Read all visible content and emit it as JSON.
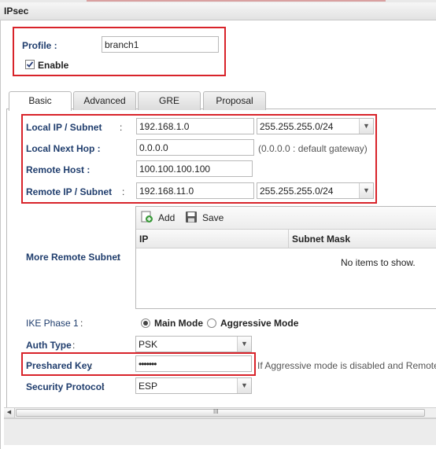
{
  "window": {
    "title": "IPsec"
  },
  "profile": {
    "label": "Profile :",
    "value": "branch1",
    "enable_label": "Enable",
    "enable_checked": true
  },
  "tabs": [
    {
      "label": "Basic",
      "active": true
    },
    {
      "label": "Advanced",
      "active": false
    },
    {
      "label": "GRE",
      "active": false
    },
    {
      "label": "Proposal",
      "active": false
    }
  ],
  "local_ip": {
    "label": "Local IP / Subnet",
    "value": "192.168.1.0",
    "mask": "255.255.255.0/24"
  },
  "local_next_hop": {
    "label": "Local Next Hop :",
    "value": "0.0.0.0",
    "hint": "(0.0.0.0 : default gateway)"
  },
  "remote_host": {
    "label": "Remote Host :",
    "value": "100.100.100.100"
  },
  "remote_ip": {
    "label": "Remote IP / Subnet",
    "value": "192.168.11.0",
    "mask": "255.255.255.0/24"
  },
  "more_remote_subnet": {
    "label": "More Remote Subnet",
    "add_label": "Add",
    "save_label": "Save",
    "columns": [
      "IP",
      "Subnet Mask"
    ],
    "empty_text": "No items to show."
  },
  "ike_phase1": {
    "label": "IKE Phase 1",
    "main_mode": "Main Mode",
    "aggressive_mode": "Aggressive Mode",
    "selected": "Main Mode"
  },
  "auth_type": {
    "label": "Auth Type",
    "value": "PSK"
  },
  "preshared_key": {
    "label": "Preshared Key",
    "value": "•••••••",
    "hint": "If Aggressive mode is disabled and Remote H"
  },
  "security_protocol": {
    "label": "Security Protocol",
    "value": "ESP"
  },
  "colors": {
    "highlight": "#d8232a",
    "label_blue": "#1f3d6d"
  },
  "scrollbar": {
    "grip": "III"
  }
}
